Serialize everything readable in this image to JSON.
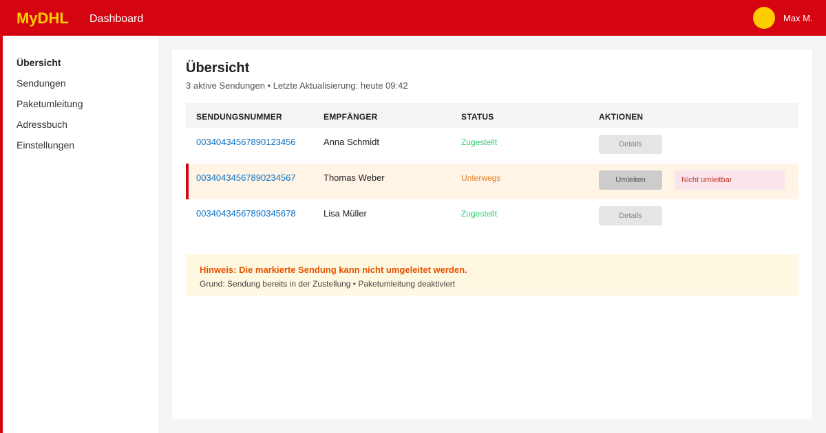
{
  "header": {
    "logo": "MyDHL",
    "title": "Dashboard",
    "user": "Max M.",
    "brand_color": "#d40511",
    "accent_color": "#ffcc00"
  },
  "sidebar": {
    "items": [
      {
        "label": "Übersicht",
        "active": true
      },
      {
        "label": "Sendungen",
        "active": false
      },
      {
        "label": "Paketumleitung",
        "active": false
      },
      {
        "label": "Adressbuch",
        "active": false
      },
      {
        "label": "Einstellungen",
        "active": false
      }
    ]
  },
  "main": {
    "title": "Übersicht",
    "subtitle": "3 aktive Sendungen • Letzte Aktualisierung: heute 09:42"
  },
  "table": {
    "columns": [
      "SENDUNGSNUMMER",
      "EMPFÄNGER",
      "STATUS",
      "AKTIONEN"
    ],
    "rows": [
      {
        "tracking": "00340434567890123456",
        "recipient": "Anna Schmidt",
        "status": "Zugestellt",
        "action": "Details",
        "note": ""
      },
      {
        "tracking": "00340434567890234567",
        "recipient": "Thomas Weber",
        "status": "Unterwegs",
        "action": "Umleiten",
        "note": "Nicht umleitbar"
      },
      {
        "tracking": "00340434567890345678",
        "recipient": "Lisa Müller",
        "status": "Zugestellt",
        "action": "Details",
        "note": ""
      }
    ]
  },
  "notice": {
    "title": "Hinweis: Die markierte Sendung kann nicht umgeleitet werden.",
    "text": "Grund: Sendung bereits in der Zustellung • Paketumleitung deaktiviert"
  }
}
